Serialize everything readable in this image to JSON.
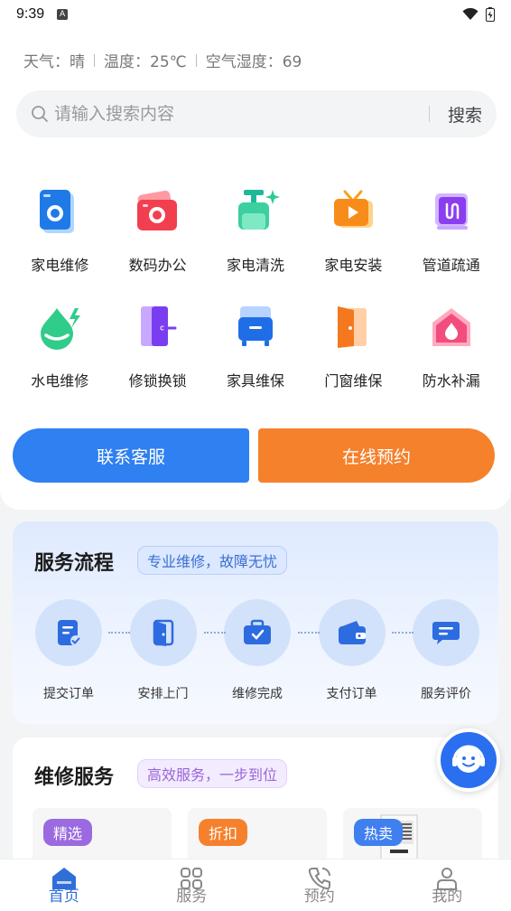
{
  "status_bar": {
    "time": "9:39",
    "app_badge": "A"
  },
  "weather": {
    "weather": "天气：晴",
    "temperature": "温度：25℃",
    "humidity": "空气湿度：69"
  },
  "search": {
    "placeholder": "请输入搜索内容",
    "button": "搜索"
  },
  "categories": [
    {
      "label": "家电维修",
      "icon": "washing-machine-icon"
    },
    {
      "label": "数码办公",
      "icon": "camera-icon"
    },
    {
      "label": "家电清洗",
      "icon": "cleaning-bottle-icon"
    },
    {
      "label": "家电安装",
      "icon": "tv-icon"
    },
    {
      "label": "管道疏通",
      "icon": "pipe-icon"
    },
    {
      "label": "水电维修",
      "icon": "water-electric-icon"
    },
    {
      "label": "修锁换锁",
      "icon": "door-lock-icon"
    },
    {
      "label": "家具维保",
      "icon": "furniture-icon"
    },
    {
      "label": "门窗维保",
      "icon": "door-window-icon"
    },
    {
      "label": "防水补漏",
      "icon": "waterproof-icon"
    }
  ],
  "actions": {
    "contact": "联系客服",
    "book": "在线预约"
  },
  "process": {
    "title": "服务流程",
    "tag": "专业维修，故障无忧",
    "steps": [
      {
        "label": "提交订单",
        "icon": "document-check-icon"
      },
      {
        "label": "安排上门",
        "icon": "door-icon"
      },
      {
        "label": "维修完成",
        "icon": "toolbox-icon"
      },
      {
        "label": "支付订单",
        "icon": "wallet-icon"
      },
      {
        "label": "服务评价",
        "icon": "chat-icon"
      }
    ]
  },
  "repair": {
    "title": "维修服务",
    "tag": "高效服务，一步到位",
    "products": [
      {
        "tag": "精选",
        "color": "#9b6ae0"
      },
      {
        "tag": "折扣",
        "color": "#f6812c"
      },
      {
        "tag": "热卖",
        "color": "#3f7ff0"
      }
    ]
  },
  "nav": [
    {
      "label": "首页",
      "icon": "home-icon",
      "active": true
    },
    {
      "label": "服务",
      "icon": "grid-icon",
      "active": false
    },
    {
      "label": "预约",
      "icon": "phone-icon",
      "active": false
    },
    {
      "label": "我的",
      "icon": "user-icon",
      "active": false
    }
  ],
  "colors": {
    "accent_blue": "#2f80f0",
    "accent_orange": "#f6812c"
  }
}
